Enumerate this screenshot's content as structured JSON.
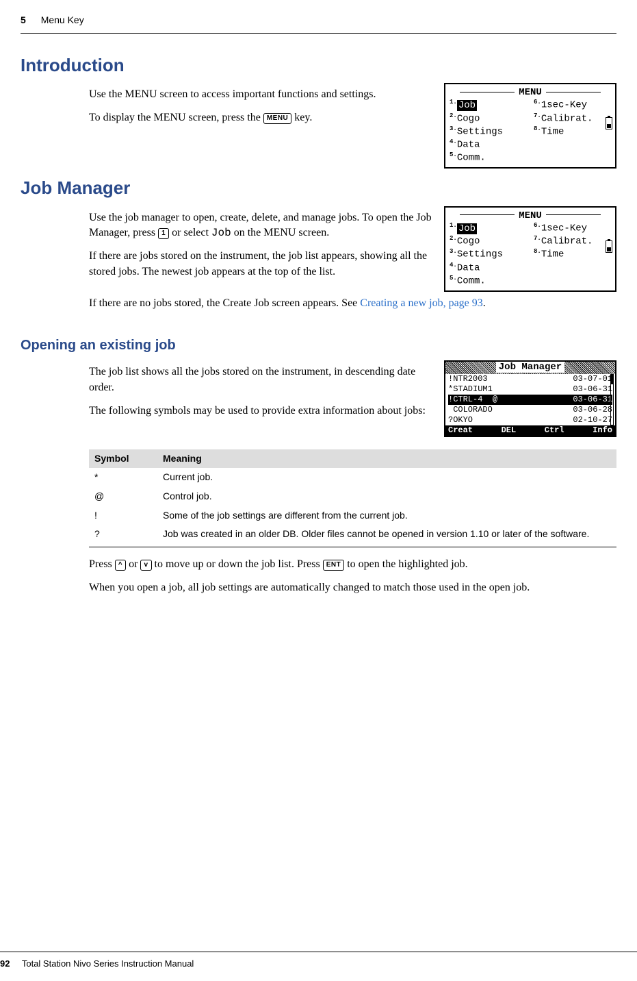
{
  "header": {
    "chapter_num": "5",
    "chapter_title": "Menu Key"
  },
  "h1_intro": "Introduction",
  "intro_p1": "Use the MENU screen to access important functions and settings.",
  "intro_p2a": "To display the MENU screen, press the ",
  "key_menu": "MENU",
  "intro_p2b": " key.",
  "lcd_menu": {
    "title": "MENU",
    "left": [
      {
        "n": "1.",
        "t": "Job",
        "hl": true
      },
      {
        "n": "2.",
        "t": "Cogo"
      },
      {
        "n": "3.",
        "t": "Settings"
      },
      {
        "n": "4.",
        "t": "Data"
      },
      {
        "n": "5.",
        "t": "Comm."
      }
    ],
    "right": [
      {
        "n": "6.",
        "t": "1sec-Key"
      },
      {
        "n": "7.",
        "t": "Calibrat."
      },
      {
        "n": "8.",
        "t": "Time"
      }
    ]
  },
  "h1_jobmgr": "Job Manager",
  "jm_p1a": "Use the job manager to open, create, delete, and manage jobs. To open the Job Manager, press ",
  "key_1": "1",
  "jm_p1b": " or select ",
  "jm_word_job": "Job",
  "jm_p1c": " on the MENU screen.",
  "jm_p2": "If there are jobs stored on the instrument, the job list appears, showing all the stored jobs. The newest job appears at the top of the list.",
  "jm_p3a": "If there are no jobs stored, the Create Job screen appears. See ",
  "jm_link": "Creating a new job, page 93",
  "jm_p3b": ".",
  "h2_open": "Opening an existing job",
  "open_p1": "The job list shows all the jobs stored on the instrument, in descending date order.",
  "open_p2": "The following symbols may be used to provide extra information about jobs:",
  "joblcd": {
    "title": "Job Manager",
    "rows": [
      {
        "pre": "!",
        "name": "NTR2003",
        "at": " ",
        "date": "03-07-01",
        "hl": false
      },
      {
        "pre": "*",
        "name": "STADIUM1",
        "at": " ",
        "date": "03-06-31",
        "hl": false
      },
      {
        "pre": "!",
        "name": "CTRL-4",
        "at": "@",
        "date": "03-06-31",
        "hl": true
      },
      {
        "pre": " ",
        "name": "COLORADO",
        "at": " ",
        "date": "03-06-28",
        "hl": false
      },
      {
        "pre": "?",
        "name": "OKYO",
        "at": " ",
        "date": "02-10-27",
        "hl": false
      }
    ],
    "softkeys": [
      "Creat",
      "DEL",
      "Ctrl",
      "Info"
    ]
  },
  "symtab": {
    "hdr": [
      "Symbol",
      "Meaning"
    ],
    "rows": [
      {
        "s": "*",
        "m": "Current job."
      },
      {
        "s": "@",
        "m": "Control job."
      },
      {
        "s": "!",
        "m": "Some of the job settings are different from the current job."
      },
      {
        "s": "?",
        "m": "Job was created in an older DB. Older files cannot be opened in version 1.10 or later of the software."
      }
    ]
  },
  "nav_a": "Press ",
  "key_up": "^",
  "nav_b": " or ",
  "key_dn": "v",
  "nav_c": " to move up or down the job list. Press ",
  "key_ent": "ENT",
  "nav_d": " to open the highlighted job.",
  "open_p3": "When you open a job, all job settings are automatically changed to match those used in the open job.",
  "footer": {
    "page": "92",
    "title": "Total Station Nivo Series Instruction Manual"
  }
}
